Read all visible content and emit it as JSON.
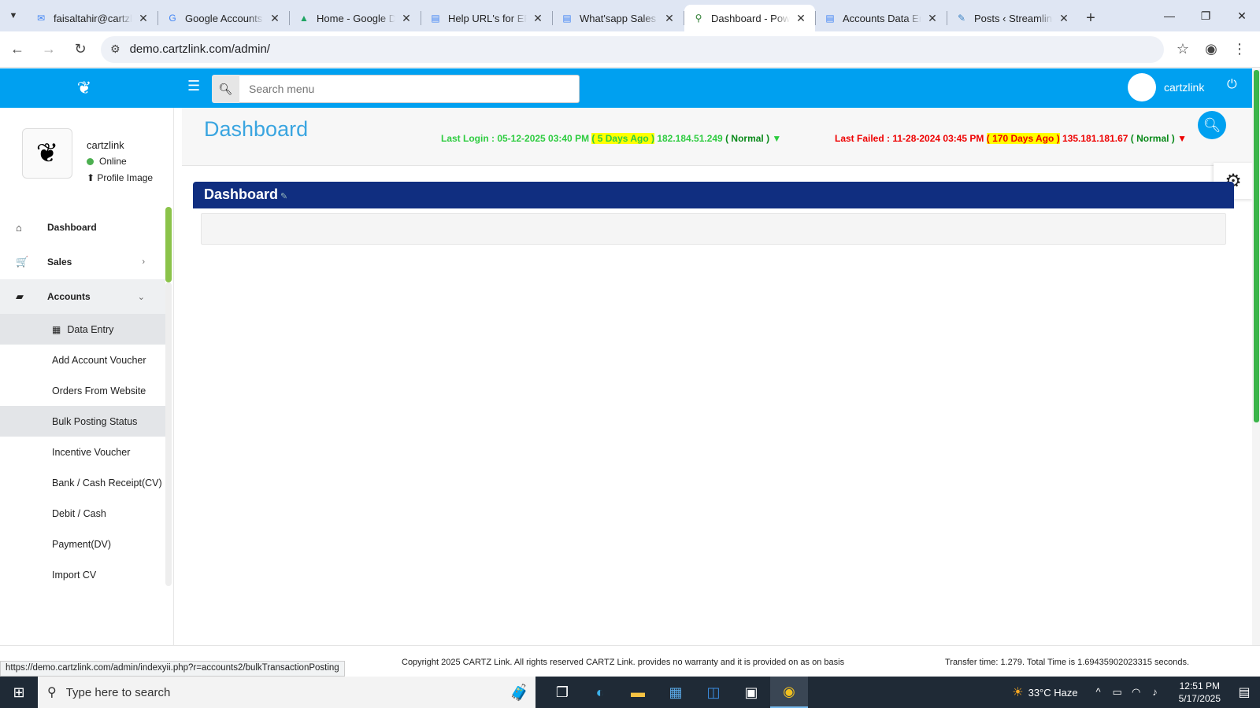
{
  "browser": {
    "tabs": [
      {
        "icon": "gmail-icon",
        "glyph": "✉",
        "color": "#4285f4",
        "title": "faisaltahir@cartzlink"
      },
      {
        "icon": "google-icon",
        "glyph": "G",
        "color": "#4285f4",
        "title": "Google Accounts"
      },
      {
        "icon": "drive-icon",
        "glyph": "▲",
        "color": "#1fa463",
        "title": "Home - Google Drive"
      },
      {
        "icon": "docs-icon",
        "glyph": "▤",
        "color": "#4285f4",
        "title": "Help URL's for ERP"
      },
      {
        "icon": "docs-icon",
        "glyph": "▤",
        "color": "#4285f4",
        "title": "What'sapp Sales Messages"
      },
      {
        "icon": "site-icon",
        "glyph": "⚲",
        "color": "#2e7d32",
        "title": "Dashboard - Power"
      },
      {
        "icon": "docs-icon",
        "glyph": "▤",
        "color": "#4285f4",
        "title": "Accounts Data Entry"
      },
      {
        "icon": "wordpress-icon",
        "glyph": "✎",
        "color": "#3b82c4",
        "title": "Posts ‹ Streamline"
      }
    ],
    "active_tab": 5,
    "url": "demo.cartzlink.com/admin/"
  },
  "header": {
    "search_placeholder": "Search menu",
    "username": "cartzlink"
  },
  "sidebar": {
    "profile_name": "cartzlink",
    "status": "Online",
    "profile_image_label": "Profile Image",
    "menu": [
      {
        "label": "Dashboard",
        "icon": "home-icon",
        "glyph": "⌂"
      },
      {
        "label": "Sales",
        "icon": "cart-icon",
        "glyph": "🛒",
        "chevron": "›"
      },
      {
        "label": "Accounts",
        "icon": "briefcase-icon",
        "glyph": "▰",
        "chevron": "⌄"
      }
    ],
    "submenu": [
      {
        "label": "Data Entry",
        "icon": "calendar-icon"
      },
      {
        "label": "Add Account Voucher"
      },
      {
        "label": "Orders From Website"
      },
      {
        "label": "Bulk Posting Status"
      },
      {
        "label": "Incentive Voucher"
      },
      {
        "label": "Bank / Cash Receipt(CV)"
      },
      {
        "label": "Debit / Cash"
      },
      {
        "label": "Payment(DV)"
      },
      {
        "label": "Import CV"
      }
    ]
  },
  "content": {
    "page_title": "Dashboard",
    "last_login": {
      "prefix": "Last Login : 05-12-2025 03:40 PM ",
      "ago": "( 5 Days Ago )",
      "ip": " 182.184.51.249 ",
      "status": "( Normal )",
      "arrow": " ▼"
    },
    "last_failed": {
      "prefix": "Last Failed : 11-28-2024 03:45 PM ",
      "ago": "( 170 Days Ago )",
      "ip": " 135.181.181.67 ",
      "status": "( Normal )",
      "arrow": " ▼"
    },
    "panel_title": "Dashboard"
  },
  "footer": {
    "copyright": "Copyright 2025 CARTZ Link. All rights reserved CARTZ Link. provides no warranty and it is provided on as on basis",
    "transfer": "Transfer time: 1.279. Total Time is 1.69435902023315 seconds.",
    "status_url": "https://demo.cartzlink.com/admin/indexyii.php?r=accounts2/bulkTransactionPosting"
  },
  "taskbar": {
    "search_placeholder": "Type here to search",
    "weather": "33°C  Haze",
    "time": "12:51 PM",
    "date": "5/17/2025"
  }
}
